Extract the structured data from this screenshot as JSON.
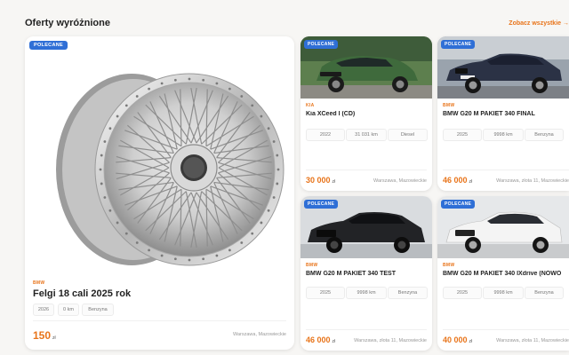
{
  "section": {
    "title": "Oferty wyróżnione",
    "see_all": "Zobacz wszystkie →"
  },
  "colors": {
    "accent": "#e8741a",
    "badge": "#2f6fd6"
  },
  "featured": {
    "badge": "POLECANE",
    "brand": "BMW",
    "model": "Felgi 18 cali 2025 rok",
    "specs": [
      "2026",
      "0 km",
      "Benzyna"
    ],
    "price": "150",
    "currency": "zł",
    "location": "Warszawa, Mazowieckie",
    "image": "chrome-wheel-rim"
  },
  "listings": [
    {
      "badge": "POLECANE",
      "brand": "KIA",
      "model": "Kia XCeed I (CD)",
      "specs": [
        "2022",
        "31 031 km",
        "Diesel"
      ],
      "price": "30 000",
      "currency": "zł",
      "location": "Warszawa, Mazowieckie",
      "image": "green-suv"
    },
    {
      "badge": "POLECANE",
      "brand": "BMW",
      "model": "BMW G20 M PAKIET 340 FINAL",
      "specs": [
        "2025",
        "9998 km",
        "Benzyna"
      ],
      "price": "46 000",
      "currency": "zł",
      "location": "Warszawa, złota 11, Mazowieckie",
      "image": "dark-blue-sedan"
    },
    {
      "badge": "POLECANE",
      "brand": "BMW",
      "model": "BMW G20 M PAKIET 340 TEST",
      "specs": [
        "2025",
        "9998 km",
        "Benzyna"
      ],
      "price": "46 000",
      "currency": "zł",
      "location": "Warszawa, złota 11, Mazowieckie",
      "image": "black-sedan"
    },
    {
      "badge": "POLECANE",
      "brand": "BMW",
      "model": "BMW G20 M PAKIET 340 IXdrive (NOWO",
      "specs": [
        "2025",
        "9998 km",
        "Benzyna"
      ],
      "price": "40 000",
      "currency": "zł",
      "location": "Warszawa, złota 11, Mazowieckie",
      "image": "white-sedan"
    }
  ]
}
